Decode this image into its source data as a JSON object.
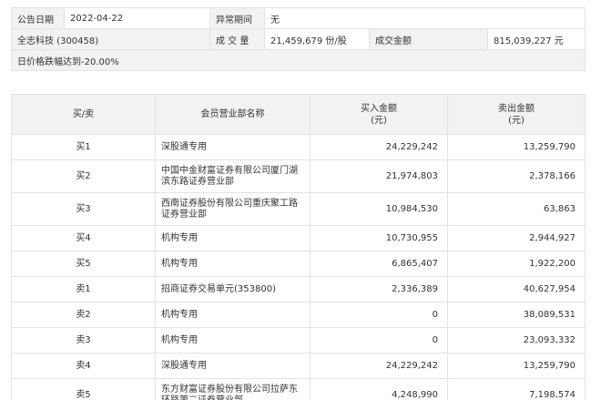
{
  "info": {
    "date_label": "公告日期",
    "date_value": "2022-04-22",
    "period_label": "异常期间",
    "period_value": "无",
    "stock": "全志科技 (300458)",
    "volume_label": "成 交 量",
    "volume_value": "21,459,679 份/股",
    "amount_label": "成交金额",
    "amount_value": "815,039,227 元",
    "reason": "日价格跌幅达到-20.00%"
  },
  "table": {
    "headers": {
      "side": "买/卖",
      "name": "会员营业部名称",
      "buy_line1": "买入金额",
      "buy_line2": "(元)",
      "sell_line1": "卖出金额",
      "sell_line2": "(元)"
    },
    "rows": [
      {
        "side": "买1",
        "name": "深股通专用",
        "buy": "24,229,242",
        "sell": "13,259,790"
      },
      {
        "side": "买2",
        "name": "中国中金财富证券有限公司厦门湖滨东路证券营业部",
        "buy": "21,974,803",
        "sell": "2,378,166"
      },
      {
        "side": "买3",
        "name": "西南证券股份有限公司重庆聚工路证券营业部",
        "buy": "10,984,530",
        "sell": "63,863"
      },
      {
        "side": "买4",
        "name": "机构专用",
        "buy": "10,730,955",
        "sell": "2,944,927"
      },
      {
        "side": "买5",
        "name": "机构专用",
        "buy": "6,865,407",
        "sell": "1,922,200"
      },
      {
        "side": "卖1",
        "name": "招商证券交易单元(353800)",
        "buy": "2,336,389",
        "sell": "40,627,954"
      },
      {
        "side": "卖2",
        "name": "机构专用",
        "buy": "0",
        "sell": "38,089,531"
      },
      {
        "side": "卖3",
        "name": "机构专用",
        "buy": "0",
        "sell": "23,093,332"
      },
      {
        "side": "卖4",
        "name": "深股通专用",
        "buy": "24,229,242",
        "sell": "13,259,790"
      },
      {
        "side": "卖5",
        "name": "东方财富证券股份有限公司拉萨东环路第二证券营业部",
        "buy": "4,248,990",
        "sell": "7,198,574"
      }
    ]
  }
}
